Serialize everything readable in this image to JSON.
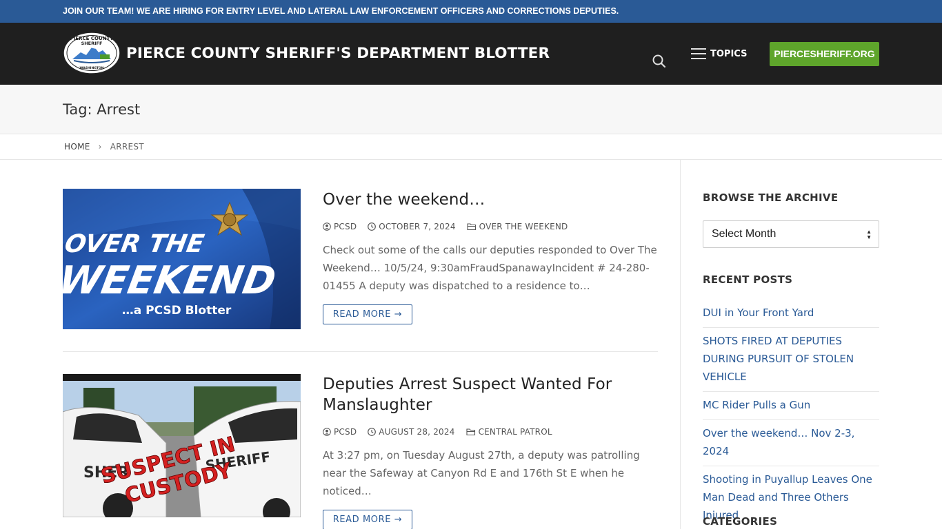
{
  "topbar": {
    "text": "JOIN OUR TEAM! WE ARE HIRING FOR ENTRY LEVEL AND LATERAL LAW ENFORCEMENT OFFICERS AND CORRECTIONS DEPUTIES."
  },
  "header": {
    "site_title": "PIERCE COUNTY SHERIFF'S DEPARTMENT BLOTTER",
    "logo_text_top": "PIERCE COUNTY",
    "logo_text_mid": "SHERIFF",
    "logo_text_bottom": "WASHINGTON",
    "menu_label": "TOPICS",
    "cta_label": "PIERCESHERIFF.ORG",
    "colors": {
      "topbar": "#2a5a96",
      "header": "#1f1f1f",
      "cta": "#5ea52b"
    }
  },
  "page": {
    "title": "Tag: Arrest"
  },
  "breadcrumb": {
    "home": "HOME",
    "current": "ARREST"
  },
  "posts": [
    {
      "title": "Over the weekend…",
      "author": "PCSD",
      "date": "OCTOBER 7, 2024",
      "category": "OVER THE WEEKEND",
      "excerpt": "Check out some of the calls our deputies responded to Over The Weekend… 10/5/24, 9:30amFraudSpanawayIncident # 24-280-01455 A deputy was dispatched to a residence to…",
      "read_more": "READ MORE →",
      "thumb": {
        "line1": "OVER THE",
        "line2": "WEEKEND",
        "line3": "…a PCSD Blotter"
      }
    },
    {
      "title": "Deputies Arrest Suspect Wanted For Manslaughter",
      "author": "PCSD",
      "date": "AUGUST 28, 2024",
      "category": "CENTRAL PATROL",
      "excerpt": "At 3:27 pm, on Tuesday August 27th, a deputy was patrolling near the Safeway at Canyon Rd E and 176th St E when he noticed…",
      "read_more": "READ MORE →",
      "thumb": {
        "line1": "SUSPECT IN",
        "line2": "CUSTODY",
        "door1": "SHER",
        "door2": "SHERIFF"
      }
    }
  ],
  "sidebar": {
    "archive_title": "BROWSE THE ARCHIVE",
    "archive_select": "Select Month",
    "recent_title": "RECENT POSTS",
    "recent_posts": [
      "DUI in Your Front Yard",
      "SHOTS FIRED AT DEPUTIES DURING PURSUIT OF STOLEN VEHICLE",
      "MC Rider Pulls a Gun",
      "Over the weekend… Nov 2-3, 2024",
      "Shooting in Puyallup Leaves One Man Dead and Three Others Injured"
    ],
    "categories_title": "CATEGORIES"
  }
}
